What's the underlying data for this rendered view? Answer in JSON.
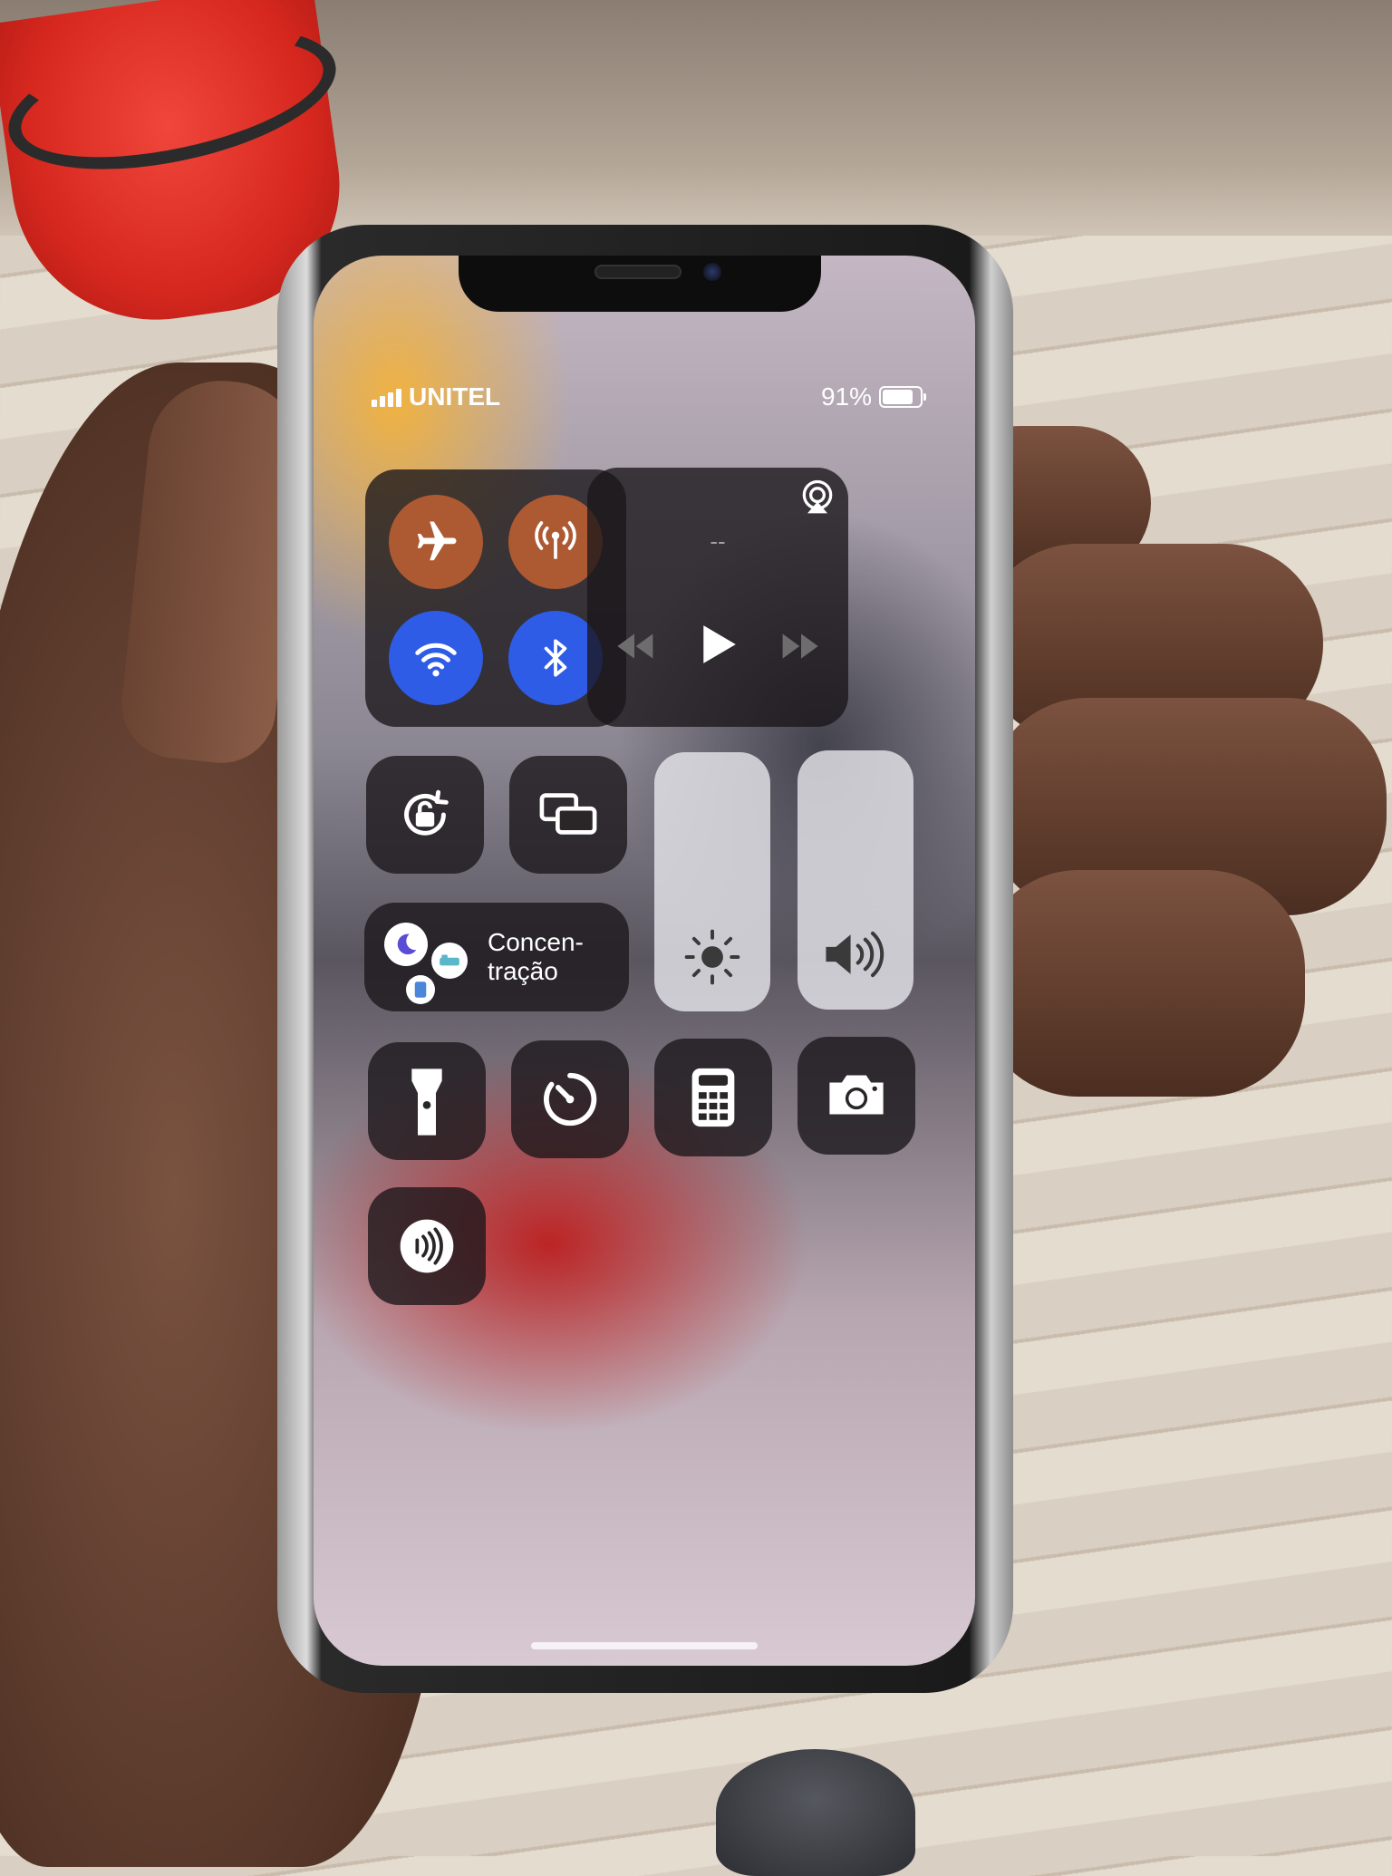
{
  "status_bar": {
    "carrier": "UNITEL",
    "battery_text": "91%",
    "battery_level": 0.91
  },
  "connectivity": {
    "airplane": {
      "icon": "airplane-icon",
      "state": "off"
    },
    "cellular": {
      "icon": "cellular-antenna-icon",
      "state": "on"
    },
    "wifi": {
      "icon": "wifi-icon",
      "state": "on"
    },
    "bluetooth": {
      "icon": "bluetooth-icon",
      "state": "on"
    }
  },
  "media": {
    "now_playing": "--",
    "controls": [
      "rewind-icon",
      "play-icon",
      "fast-forward-icon"
    ]
  },
  "focus": {
    "label": "Concen-\ntração"
  },
  "sliders": {
    "brightness_icon": "sun-icon",
    "volume_icon": "speaker-icon"
  },
  "shortcuts": [
    "rotation-lock-icon",
    "screen-mirroring-icon",
    "flashlight-icon",
    "timer-icon",
    "calculator-icon",
    "camera-icon",
    "nfc-reader-icon"
  ],
  "colors": {
    "active_blue": "#2e5ce6",
    "active_orange": "#ad5a33",
    "tile_dark": "#191619"
  }
}
